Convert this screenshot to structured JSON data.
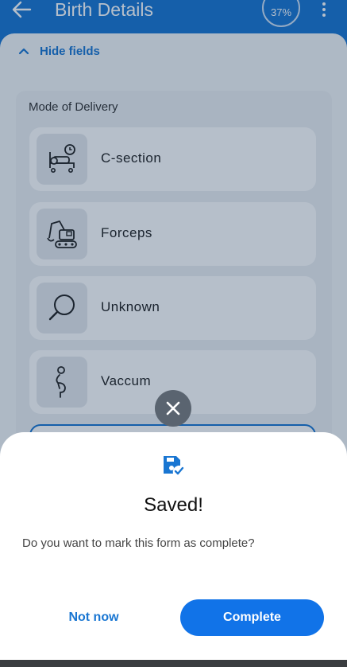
{
  "appbar": {
    "title": "Birth Details",
    "progress": "37%",
    "icons": {
      "back": "arrow-left-icon",
      "menu": "more-vert-icon"
    }
  },
  "form": {
    "toggle_label": "Hide fields",
    "section_label": "Mode of Delivery",
    "options": [
      {
        "label": "C-section",
        "icon": "bed-clock-icon"
      },
      {
        "label": "Forceps",
        "icon": "excavator-icon"
      },
      {
        "label": "Unknown",
        "icon": "magnifier-icon"
      },
      {
        "label": "Vaccum",
        "icon": "pregnant-icon"
      }
    ]
  },
  "dialog": {
    "icon": "save-check-icon",
    "title": "Saved!",
    "message": "Do you want to mark this form as complete?",
    "secondary_label": "Not now",
    "primary_label": "Complete",
    "close_icon": "close-icon"
  },
  "colors": {
    "primary": "#1976d2",
    "button": "#1173e8"
  }
}
